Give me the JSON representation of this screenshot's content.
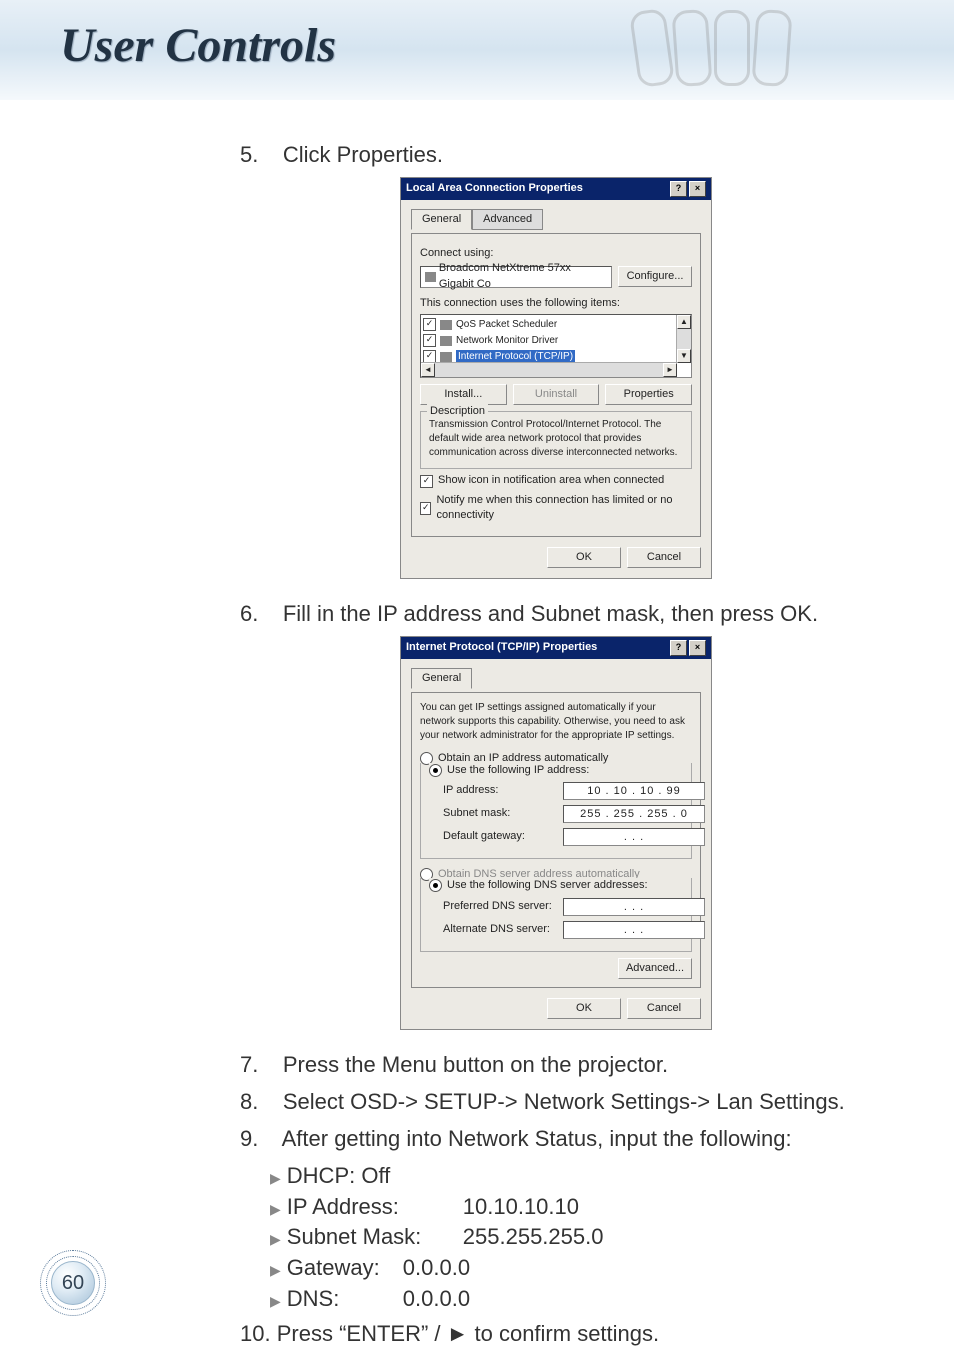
{
  "header": {
    "title": "User Controls"
  },
  "steps": {
    "s5": {
      "num": "5.",
      "text": "Click Properties."
    },
    "s6": {
      "num": "6.",
      "text": "Fill in the IP address and Subnet mask, then press OK."
    },
    "s7": {
      "num": "7.",
      "text": "Press the Menu button on the projector."
    },
    "s8": {
      "num": "8.",
      "text": "Select OSD-> SETUP-> Network Settings-> Lan Settings."
    },
    "s9": {
      "num": "9.",
      "text": "After getting into Network Status, input the following:"
    },
    "s10": {
      "num": "10.",
      "text": "Press “ENTER” / ► to confirm settings."
    }
  },
  "bullets": {
    "dhcp_label": "DHCP: Off",
    "ip_label": "IP Address:",
    "ip_value": "10.10.10.10",
    "subnet_label": "Subnet Mask:",
    "subnet_value": "255.255.255.0",
    "gateway_label": "Gateway:",
    "gateway_value": "0.0.0.0",
    "dns_label": "DNS:",
    "dns_value": "0.0.0.0"
  },
  "dlg1": {
    "title": "Local Area Connection Properties",
    "tab_general": "General",
    "tab_advanced": "Advanced",
    "connect_using_label": "Connect using:",
    "adapter": "Broadcom NetXtreme 57xx Gigabit Co",
    "configure_btn": "Configure...",
    "items_label": "This connection uses the following items:",
    "item_qos": "QoS Packet Scheduler",
    "item_nmd": "Network Monitor Driver",
    "item_tcpip": "Internet Protocol (TCP/IP)",
    "install_btn": "Install...",
    "uninstall_btn": "Uninstall",
    "properties_btn": "Properties",
    "desc_title": "Description",
    "desc_text": "Transmission Control Protocol/Internet Protocol. The default wide area network protocol that provides communication across diverse interconnected networks.",
    "check_show_icon": "Show icon in notification area when connected",
    "check_notify": "Notify me when this connection has limited or no connectivity",
    "ok_btn": "OK",
    "cancel_btn": "Cancel"
  },
  "dlg2": {
    "title": "Internet Protocol (TCP/IP) Properties",
    "tab_general": "General",
    "intro": "You can get IP settings assigned automatically if your network supports this capability. Otherwise, you need to ask your network administrator for the appropriate IP settings.",
    "radio_auto_ip": "Obtain an IP address automatically",
    "radio_use_ip": "Use the following IP address:",
    "ip_label": "IP address:",
    "ip_value": "10 . 10 . 10 . 99",
    "subnet_label": "Subnet mask:",
    "subnet_value": "255 . 255 . 255 . 0",
    "gateway_label": "Default gateway:",
    "gateway_value": ".     .     .",
    "radio_auto_dns": "Obtain DNS server address automatically",
    "radio_use_dns": "Use the following DNS server addresses:",
    "pref_dns_label": "Preferred DNS server:",
    "alt_dns_label": "Alternate DNS server:",
    "dns_blank": ".     .     .",
    "advanced_btn": "Advanced...",
    "ok_btn": "OK",
    "cancel_btn": "Cancel"
  },
  "page_number": "60"
}
